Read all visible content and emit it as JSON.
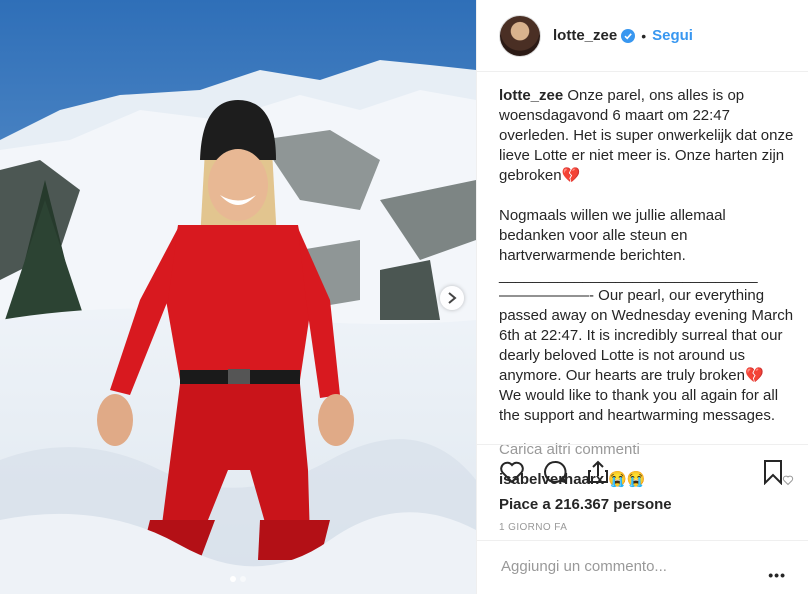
{
  "header": {
    "username": "lotte_zee",
    "separator": "•",
    "follow_label": "Segui"
  },
  "caption": {
    "username": "lotte_zee",
    "text": "Onze parel, ons alles is op woensdagavond 6 maart om 22:47 overleden. Het is super onwerkelijk dat onze lieve Lotte er niet meer is. Onze harten zijn gebroken💔\n\nNogmaals willen we jullie allemaal bedanken voor alle steun en hartverwarmende berichten.\n_______________________________\n——————- Our pearl, our everything passed away on Wednesday evening March 6th at 22:47. It is incredibly surreal that our dearly beloved Lotte is not around us anymore. Our hearts are truly broken💔\nWe would like to thank you all again for all the support and heartwarming messages."
  },
  "load_more_label": "Carica altri commenti",
  "comment": {
    "username": "isabelverhaarx",
    "text": "😭😭"
  },
  "likes_text": "Piace a 216.367 persone",
  "timestamp": "1 GIORNO FA",
  "add_comment": {
    "placeholder": "Aggiungi un commento..."
  },
  "more_label": "•••",
  "carousel": {
    "count": 2,
    "active": 1
  },
  "colors": {
    "accent": "#3897f0",
    "suit": "#d8191f",
    "text": "#262626",
    "muted": "#999999"
  }
}
